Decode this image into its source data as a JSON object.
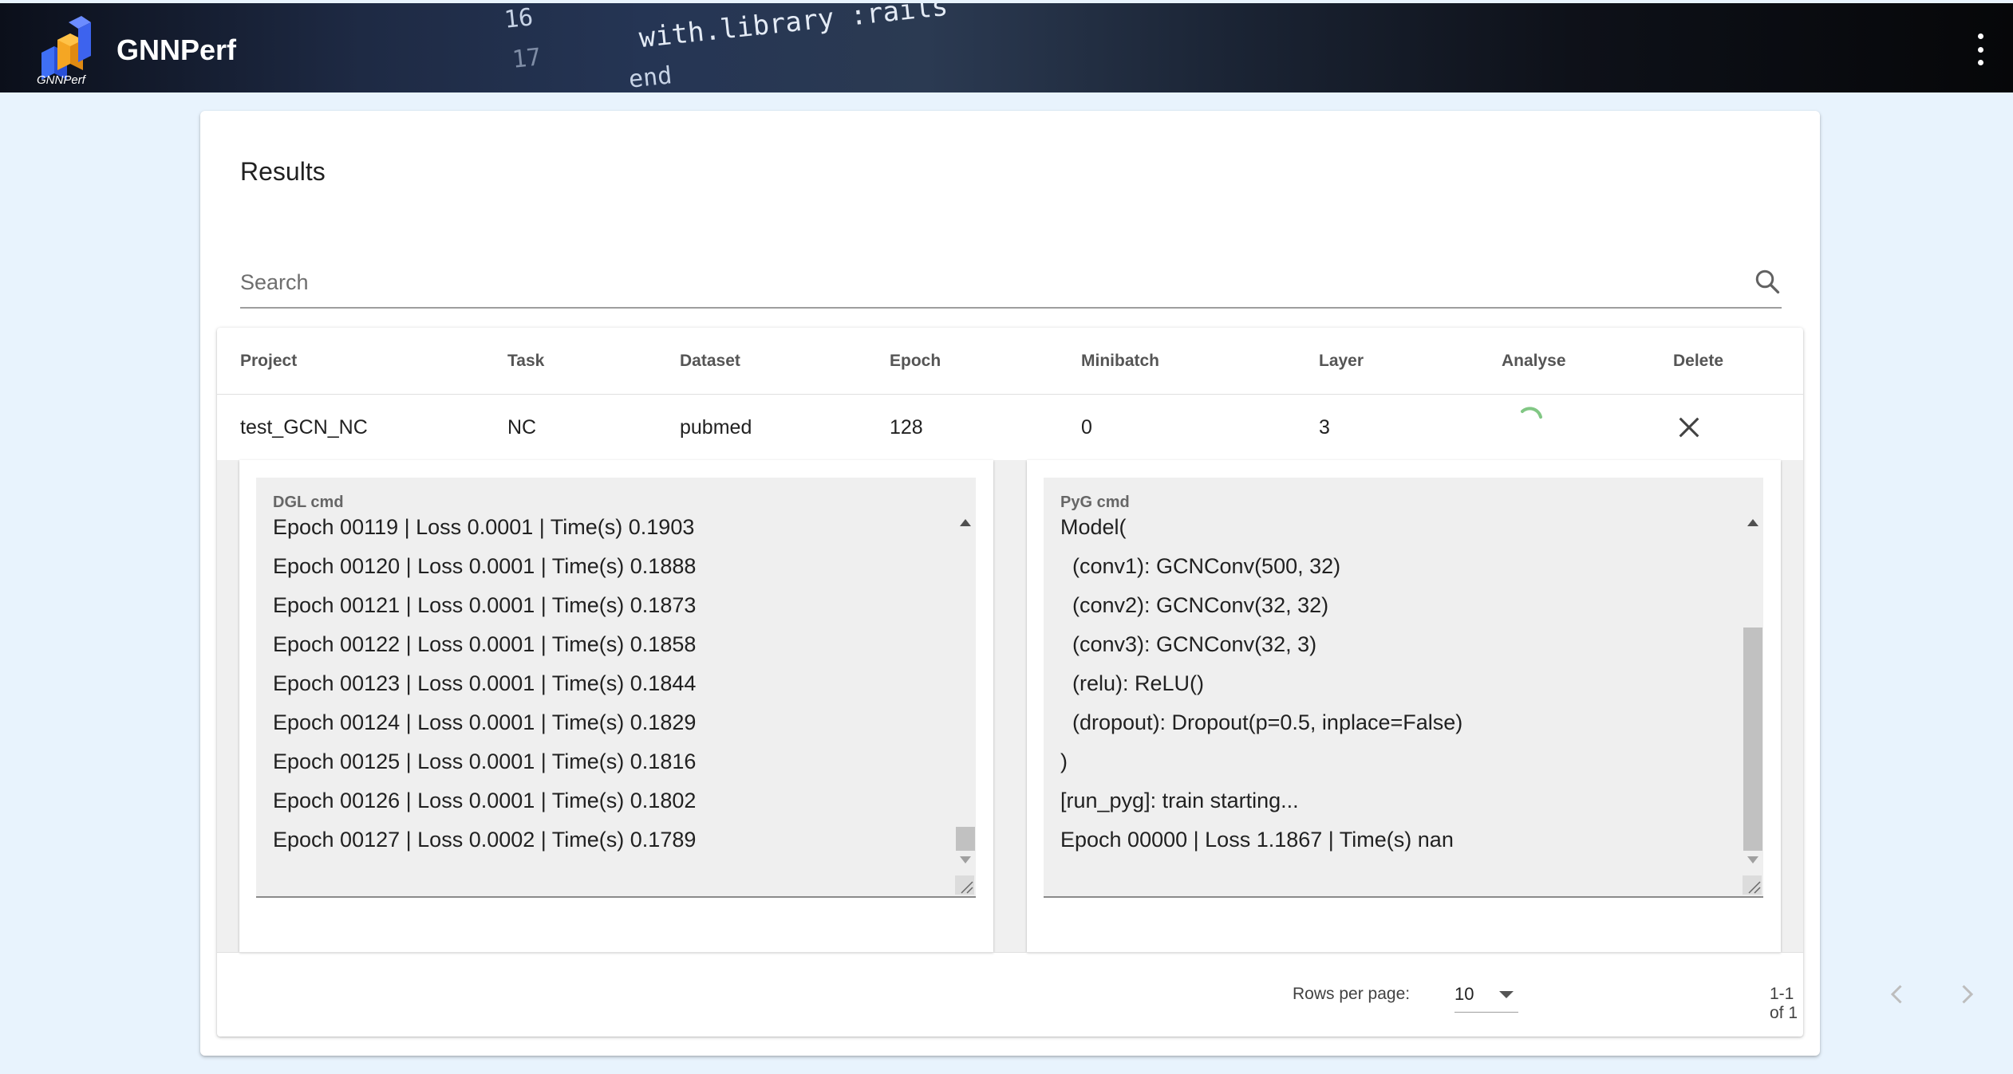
{
  "app": {
    "title": "GNNPerf",
    "logo_caption": "GNNPerf",
    "menu_icon": "more-vert-icon",
    "banner_code": [
      "16",
      "17",
      "with.library :rails",
      "end"
    ]
  },
  "results": {
    "heading": "Results",
    "search": {
      "placeholder": "Search",
      "icon": "search-icon"
    },
    "columns": [
      "Project",
      "Task",
      "Dataset",
      "Epoch",
      "Minibatch",
      "Layer",
      "Analyse",
      "Delete"
    ],
    "rows": [
      {
        "project": "test_GCN_NC",
        "task": "NC",
        "dataset": "pubmed",
        "epoch": "128",
        "minibatch": "0",
        "layer": "3",
        "analyse_icon": "loading-spinner-icon",
        "delete_icon": "close-icon"
      }
    ],
    "details": {
      "dgl": {
        "label": "DGL cmd",
        "lines": [
          "Epoch 00119 | Loss 0.0001 | Time(s) 0.1903",
          "Epoch 00120 | Loss 0.0001 | Time(s) 0.1888",
          "Epoch 00121 | Loss 0.0001 | Time(s) 0.1873",
          "Epoch 00122 | Loss 0.0001 | Time(s) 0.1858",
          "Epoch 00123 | Loss 0.0001 | Time(s) 0.1844",
          "Epoch 00124 | Loss 0.0001 | Time(s) 0.1829",
          "Epoch 00125 | Loss 0.0001 | Time(s) 0.1816",
          "Epoch 00126 | Loss 0.0001 | Time(s) 0.1802",
          "Epoch 00127 | Loss 0.0002 | Time(s) 0.1789"
        ],
        "scroll_position": 1.0
      },
      "pyg": {
        "label": "PyG cmd",
        "lines": [
          "Model(",
          "  (conv1): GCNConv(500, 32)",
          "  (conv2): GCNConv(32, 32)",
          "  (conv3): GCNConv(32, 3)",
          "  (relu): ReLU()",
          "  (dropout): Dropout(p=0.5, inplace=False)",
          ")",
          "[run_pyg]: train starting...",
          "Epoch 00000 | Loss 1.1867 | Time(s) nan"
        ],
        "scroll_position": 1.0
      }
    },
    "pagination": {
      "rows_per_page_label": "Rows per page:",
      "rows_per_page": "10",
      "range": "1-1 of 1",
      "prev_icon": "chevron-left-icon",
      "next_icon": "chevron-right-icon"
    }
  },
  "colors": {
    "page_background": "#e8f3fd",
    "appbar": "#1e2a44",
    "spinner": "#81c784",
    "log_background": "#efefef"
  }
}
